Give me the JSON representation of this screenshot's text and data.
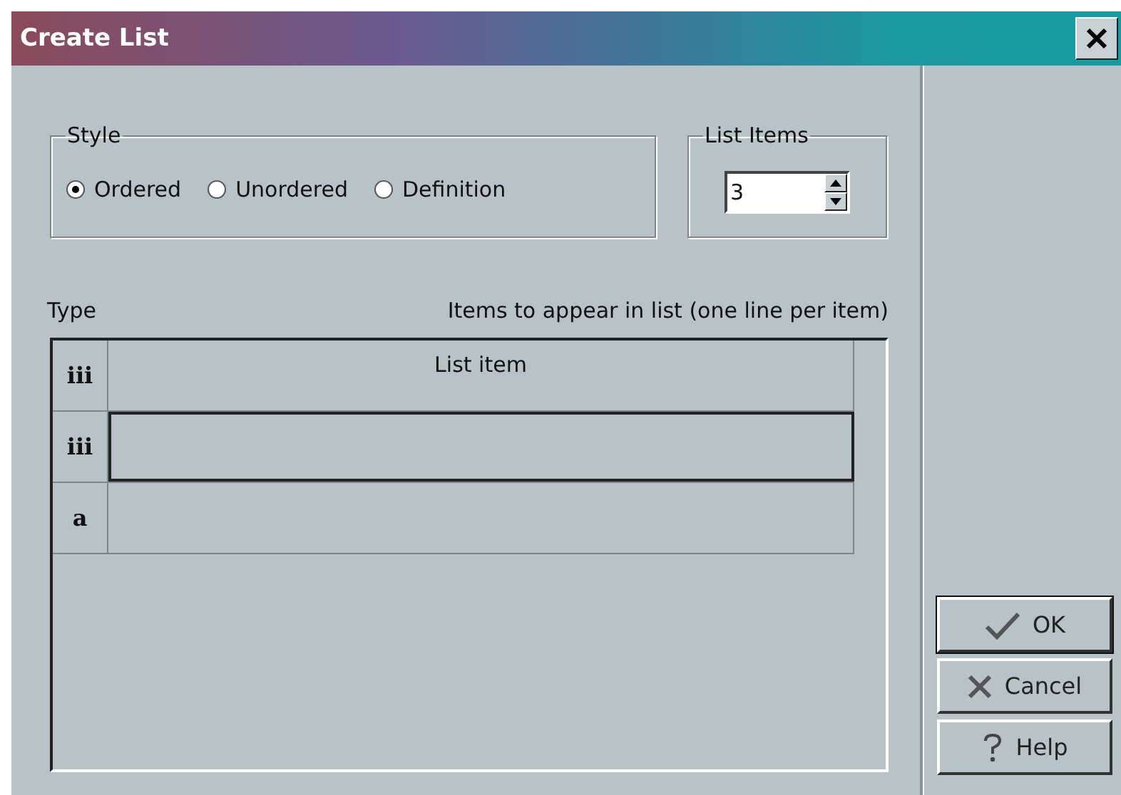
{
  "window": {
    "title": "Create List"
  },
  "style_group": {
    "label": "Style",
    "options": [
      {
        "label": "Ordered",
        "selected": true
      },
      {
        "label": "Unordered",
        "selected": false
      },
      {
        "label": "Definition",
        "selected": false
      }
    ]
  },
  "list_items": {
    "label": "List Items",
    "value": "3"
  },
  "type_label": "Type",
  "items_label": "Items to appear in list (one line per item)",
  "rows": [
    {
      "type": "iii",
      "text": "List item",
      "selected": false
    },
    {
      "type": "iii",
      "selected": true
    },
    {
      "type": "a",
      "selected": false
    }
  ],
  "buttons": [
    {
      "kind": "ok",
      "label": "OK"
    },
    {
      "kind": "cancel",
      "label": "Cancel"
    },
    {
      "kind": "help",
      "label": "Help"
    }
  ]
}
